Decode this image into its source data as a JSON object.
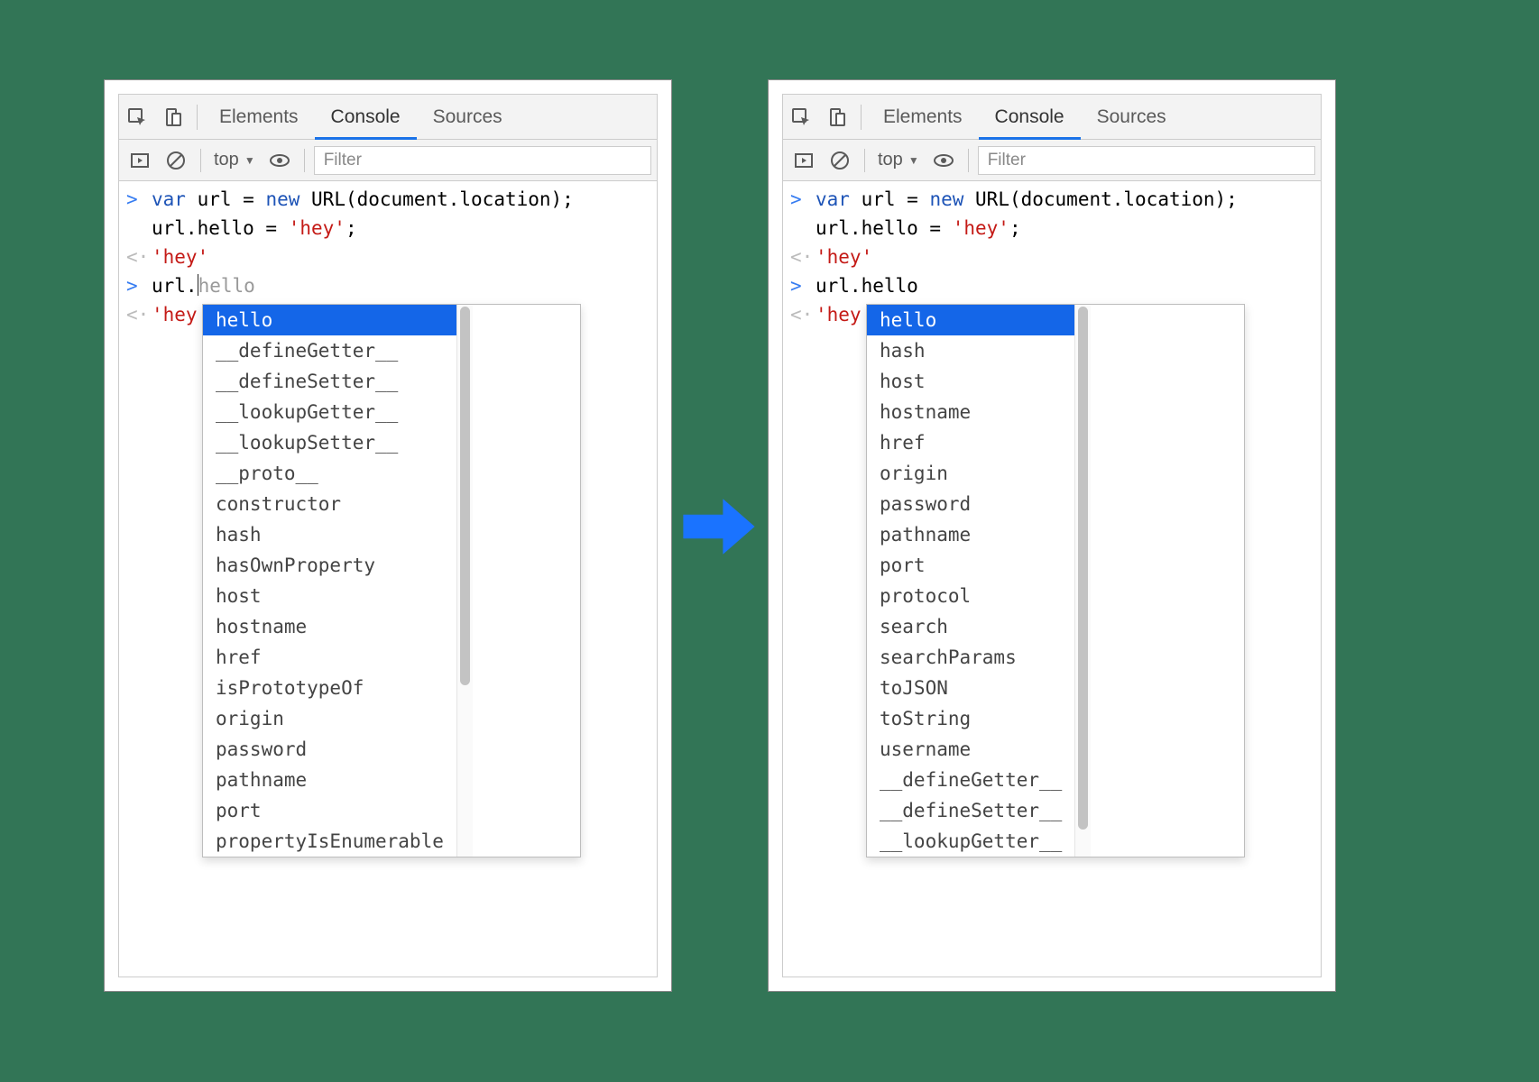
{
  "tabs": {
    "elements": "Elements",
    "console": "Console",
    "sources": "Sources"
  },
  "toolbar": {
    "context": "top",
    "filter_placeholder": "Filter"
  },
  "code": {
    "line1_var": "var",
    "line1_rest1": " url = ",
    "line1_new": "new",
    "line1_rest2": " URL(document.location);",
    "line2": "url.hello = ",
    "line2_str": "'hey'",
    "line2_semi": ";",
    "out1": "'hey'",
    "line3_pre": "url.",
    "line3_post": "hello",
    "out2": "'hey'"
  },
  "gutters": {
    "in": ">",
    "out": "<·"
  },
  "popup_left": {
    "selected": "hello",
    "items": [
      "hello",
      "__defineGetter__",
      "__defineSetter__",
      "__lookupGetter__",
      "__lookupSetter__",
      "__proto__",
      "constructor",
      "hash",
      "hasOwnProperty",
      "host",
      "hostname",
      "href",
      "isPrototypeOf",
      "origin",
      "password",
      "pathname",
      "port",
      "propertyIsEnumerable"
    ]
  },
  "popup_right": {
    "selected": "hello",
    "items": [
      "hello",
      "hash",
      "host",
      "hostname",
      "href",
      "origin",
      "password",
      "pathname",
      "port",
      "protocol",
      "search",
      "searchParams",
      "toJSON",
      "toString",
      "username",
      "__defineGetter__",
      "__defineSetter__",
      "__lookupGetter__"
    ]
  }
}
